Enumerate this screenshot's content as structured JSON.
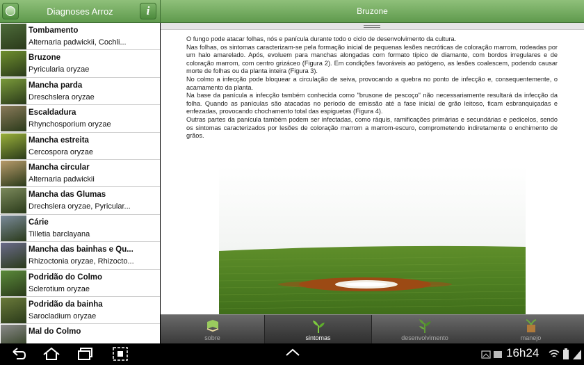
{
  "left_header": {
    "title": "Diagnoses Arroz",
    "back_icon": "back-circle-icon",
    "info_label": "i"
  },
  "right_header": {
    "title": "Bruzone"
  },
  "diseases": [
    {
      "name": "Tombamento",
      "pathogen": "Alternaria padwickii, Cochli...",
      "thumb": "#4d6b3a"
    },
    {
      "name": "Bruzone",
      "pathogen": "Pyricularia oryzae",
      "thumb": "#6f8f2e"
    },
    {
      "name": "Mancha parda",
      "pathogen": "Dreschslera oryzae",
      "thumb": "#7a9a3a"
    },
    {
      "name": "Escaldadura",
      "pathogen": "Rhynchosporium oryzae",
      "thumb": "#8a7a5a"
    },
    {
      "name": "Mancha estreita",
      "pathogen": "Cercospora oryzae",
      "thumb": "#9ab03a"
    },
    {
      "name": "Mancha circular",
      "pathogen": "Alternaria padwickii",
      "thumb": "#b89a6a"
    },
    {
      "name": "Mancha das Glumas",
      "pathogen": "Drechslera oryzae, Pyricular...",
      "thumb": "#7c8a5c"
    },
    {
      "name": "Cárie",
      "pathogen": "Tilletia barclayana",
      "thumb": "#7a8a9a"
    },
    {
      "name": "Mancha das bainhas e Qu...",
      "pathogen": "Rhizoctonia oryzae, Rhizocto...",
      "thumb": "#6a6a8a"
    },
    {
      "name": "Podridão do Colmo",
      "pathogen": "Sclerotium oryzae",
      "thumb": "#5a8a3a"
    },
    {
      "name": "Podridão da bainha",
      "pathogen": "Sarocladium oryzae",
      "thumb": "#6a7a3a"
    },
    {
      "name": "Mal do Colmo",
      "pathogen": "",
      "thumb": "#8a8a8a"
    }
  ],
  "article": [
    "O fungo pode atacar folhas, nós e panícula durante todo o ciclo de desenvolvimento da cultura.",
    "Nas folhas, os sintomas caracterizam-se pela formação inicial de pequenas lesões necróticas de coloração marrom, rodeadas por um halo amarelado. Após, evoluem para manchas alongadas com formato típico de diamante, com bordos irregulares e de coloração marrom, com centro grizáceo (Figura 2). Em condições favoráveis ao patógeno, as lesões coalescem, podendo causar morte de folhas ou da planta inteira (Figura 3).",
    "No colmo a infecção pode bloquear a circulação de seiva, provocando a quebra no ponto de infecção e, consequentemente, o acamamento da planta.",
    "Na base da panícula a infecção também conhecida como \"brusone de pescoço\" não necessariamente resultará da infecção da folha. Quando as panículas são atacadas no período de emissão até a fase inicial de grão leitoso, ficam esbranquiçadas e enfezadas, provocando chochamento total das espiguetas (Figura 4).",
    "Outras partes da panícula também podem ser infectadas, como ráquis, ramificações primárias e secundárias e pedicelos, sendo os sintomas caracterizados por lesões de coloração marrom a marrom-escuro, comprometendo indiretamente o enchimento de grãos."
  ],
  "tabs": [
    {
      "label": "sobre",
      "icon": "book-icon",
      "active": false
    },
    {
      "label": "sintomas",
      "icon": "sprout-icon",
      "active": true
    },
    {
      "label": "desenvolvimento",
      "icon": "plant-growth-icon",
      "active": false
    },
    {
      "label": "manejo",
      "icon": "watering-can-icon",
      "active": false
    }
  ],
  "status_bar": {
    "time": "16h24"
  }
}
